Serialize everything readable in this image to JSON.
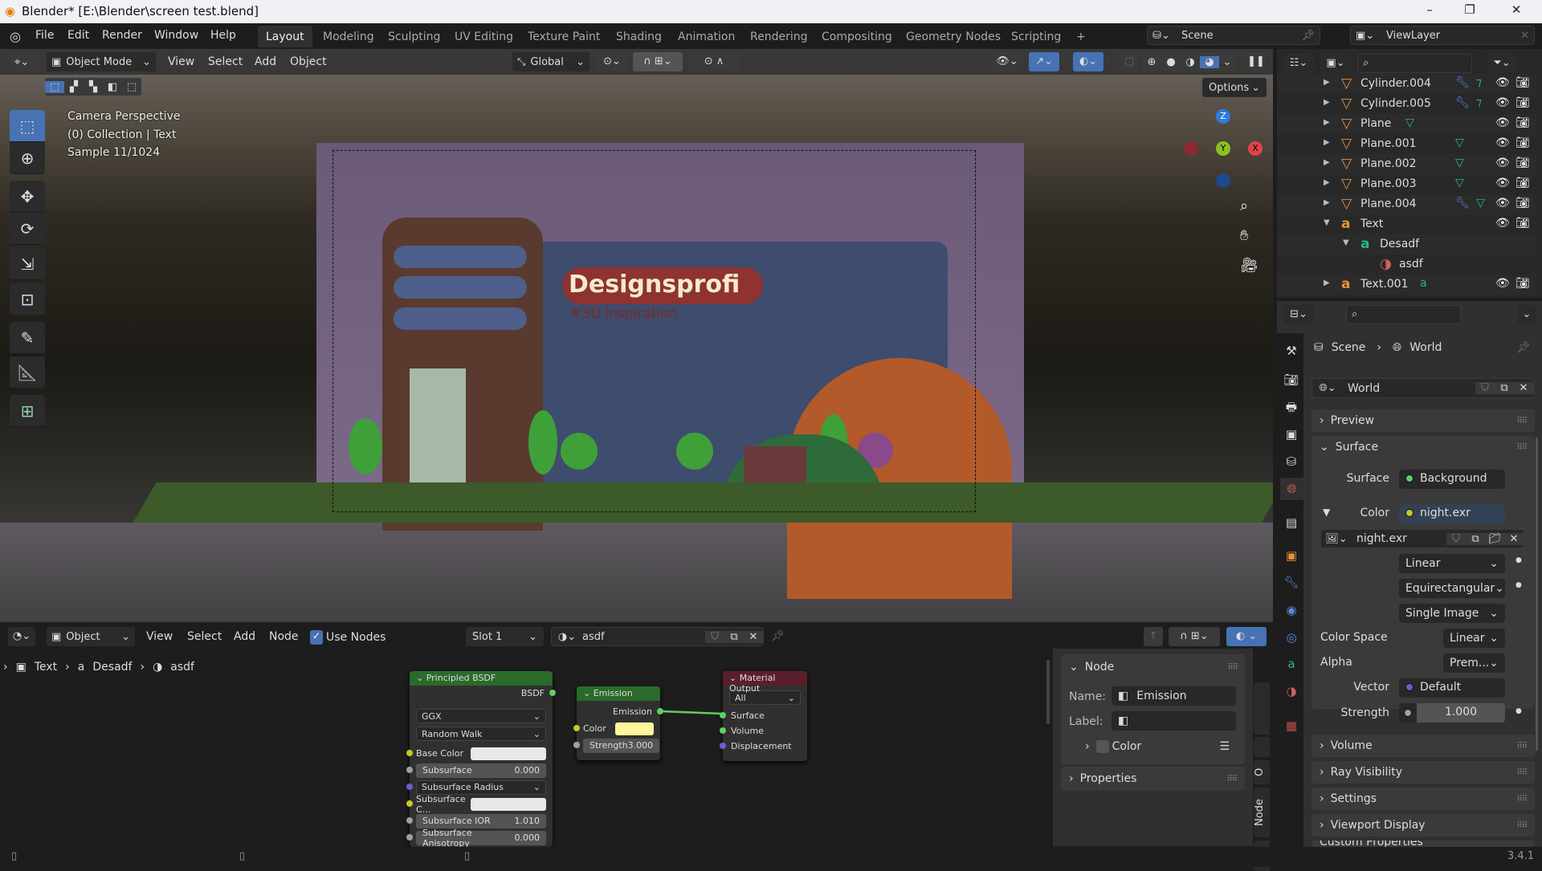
{
  "window": {
    "title": "Blender* [E:\\Blender\\screen test.blend]",
    "minimize": "–",
    "maximize": "❐",
    "close": "✕"
  },
  "menubar": {
    "items": [
      "File",
      "Edit",
      "Render",
      "Window",
      "Help"
    ],
    "workspaces": [
      "Layout",
      "Modeling",
      "Sculpting",
      "UV Editing",
      "Texture Paint",
      "Shading",
      "Animation",
      "Rendering",
      "Compositing",
      "Geometry Nodes",
      "Scripting",
      "+"
    ],
    "active_workspace": "Layout",
    "scene": "Scene",
    "view_layer": "ViewLayer"
  },
  "viewport": {
    "mode": "Object Mode",
    "menus": [
      "View",
      "Select",
      "Add",
      "Object"
    ],
    "orientation": "Global",
    "options": "Options",
    "overlay": {
      "line1": "Camera Perspective",
      "line2": "(0) Collection | Text",
      "line3": "Sample 11/1024"
    },
    "scene_text": {
      "title": "Designsprofi",
      "subtitle": "#3D inspiration"
    },
    "gizmo": {
      "x": "X",
      "y": "Y",
      "z": "Z"
    },
    "colors": {
      "x": "#e0424a",
      "y": "#8cc020",
      "z": "#2c7ce0"
    }
  },
  "node_editor": {
    "type": "Object",
    "menus": [
      "View",
      "Select",
      "Add",
      "Node"
    ],
    "use_nodes_label": "Use Nodes",
    "use_nodes": true,
    "slot": "Slot 1",
    "material": "asdf",
    "breadcrumb": [
      "Text",
      "Desadf",
      "asdf"
    ],
    "nodes": {
      "principled": {
        "title": "Principled BSDF",
        "output": "BSDF",
        "distribution": "GGX",
        "subsurface_method": "Random Walk",
        "rows": [
          {
            "label": "Base Color",
            "type": "color",
            "value": ""
          },
          {
            "label": "Subsurface",
            "type": "value",
            "value": "0.000"
          },
          {
            "label": "Subsurface Radius",
            "type": "dropdown",
            "value": ""
          },
          {
            "label": "Subsurface C...",
            "type": "color",
            "value": ""
          },
          {
            "label": "Subsurface IOR",
            "type": "value",
            "value": "1.010"
          },
          {
            "label": "Subsurface Anisotropy",
            "type": "value",
            "value": "0.000"
          }
        ]
      },
      "emission": {
        "title": "Emission",
        "output": "Emission",
        "color_label": "Color",
        "color": "#fff59a",
        "strength_label": "Strength",
        "strength": "3.000"
      },
      "output": {
        "title": "Material Output",
        "target": "All",
        "inputs": [
          "Surface",
          "Volume",
          "Displacement"
        ]
      }
    },
    "sidebar": {
      "panel": "Node",
      "name_label": "Name:",
      "name": "Emission",
      "label_label": "Label:",
      "label": "",
      "color": "Color",
      "properties": "Properties",
      "tabs": [
        "O",
        "Node",
        "Arr"
      ]
    }
  },
  "outliner": {
    "items": [
      {
        "name": "Cylinder.004",
        "indent": 0,
        "expanded": false,
        "type": "mesh",
        "extras": [
          "wrench",
          "vgroup"
        ],
        "visible": true
      },
      {
        "name": "Cylinder.005",
        "indent": 0,
        "expanded": false,
        "type": "mesh",
        "extras": [
          "wrench",
          "vgroup"
        ],
        "visible": true
      },
      {
        "name": "Plane",
        "indent": 0,
        "expanded": false,
        "type": "mesh",
        "extras": [
          "meshdata"
        ],
        "visible": true
      },
      {
        "name": "Plane.001",
        "indent": 0,
        "expanded": false,
        "type": "mesh",
        "extras": [
          "meshdata"
        ],
        "visible": true
      },
      {
        "name": "Plane.002",
        "indent": 0,
        "expanded": false,
        "type": "mesh",
        "extras": [
          "meshdata"
        ],
        "visible": true
      },
      {
        "name": "Plane.003",
        "indent": 0,
        "expanded": false,
        "type": "mesh",
        "extras": [
          "meshdata"
        ],
        "visible": true
      },
      {
        "name": "Plane.004",
        "indent": 0,
        "expanded": false,
        "type": "mesh",
        "extras": [
          "wrench",
          "meshdata"
        ],
        "visible": true
      },
      {
        "name": "Text",
        "indent": 0,
        "expanded": true,
        "type": "text",
        "extras": [],
        "visible": true
      },
      {
        "name": "Desadf",
        "indent": 1,
        "expanded": true,
        "type": "textdata",
        "extras": [],
        "visible": false
      },
      {
        "name": "asdf",
        "indent": 2,
        "expanded": false,
        "type": "material",
        "extras": [],
        "visible": false
      },
      {
        "name": "Text.001",
        "indent": 0,
        "expanded": false,
        "type": "text",
        "extras": [
          "textdata"
        ],
        "visible": true
      }
    ]
  },
  "properties": {
    "breadcrumb": [
      "Scene",
      "World"
    ],
    "world": "World",
    "sections": {
      "preview": "Preview",
      "surface": "Surface",
      "volume": "Volume",
      "ray_visibility": "Ray Visibility",
      "settings": "Settings",
      "viewport_display": "Viewport Display",
      "custom_properties": "Custom Properties"
    },
    "surface": {
      "surface_label": "Surface",
      "surface": "Background",
      "color_label": "Color",
      "color": "night.exr",
      "image": "night.exr",
      "interpolation": "Linear",
      "projection": "Equirectangular",
      "source": "Single Image",
      "color_space_label": "Color Space",
      "color_space": "Linear",
      "alpha_label": "Alpha",
      "alpha": "Prem...",
      "vector_label": "Vector",
      "vector": "Default",
      "strength_label": "Strength",
      "strength": "1.000"
    }
  },
  "status": {
    "version": "3.4.1"
  }
}
